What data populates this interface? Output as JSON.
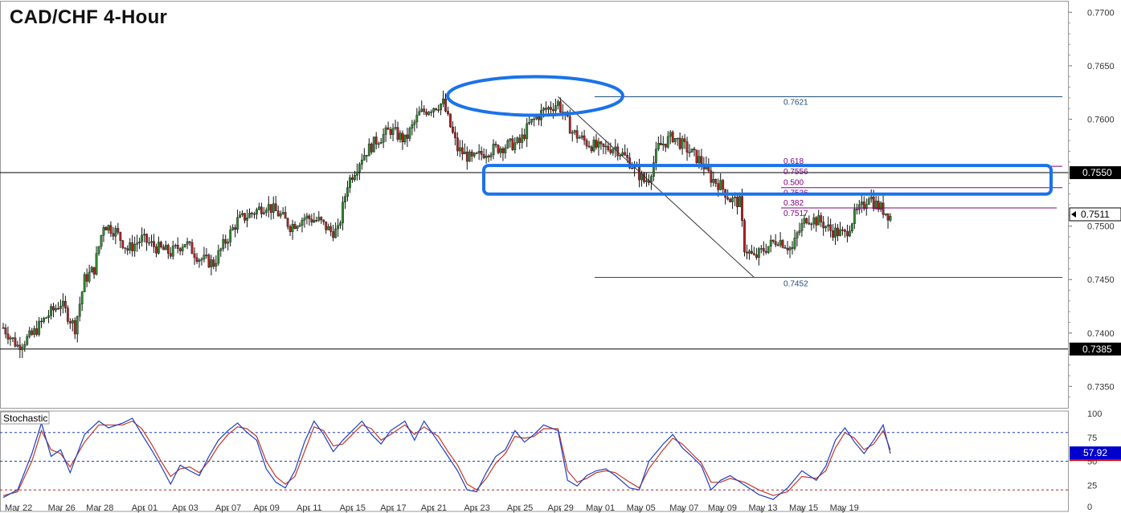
{
  "chart_data": {
    "type": "candlestick",
    "title": "CAD/CHF 4-Hour",
    "price_axis": {
      "ylim": [
        0.733,
        0.771
      ],
      "ticks": [
        "0.7350",
        "0.7400",
        "0.7450",
        "0.7500",
        "0.7550",
        "0.7600",
        "0.7650",
        "0.7700"
      ],
      "current_price_label": "0.7511",
      "current_price": 0.7511,
      "marked_levels": [
        {
          "label": "0.7550",
          "value": 0.755,
          "style": "black-horizontal"
        },
        {
          "label": "0.7385",
          "value": 0.7385,
          "style": "black-horizontal"
        }
      ]
    },
    "x_labels": [
      "Mar 22",
      "Mar 26",
      "Mar 28",
      "Apr 01",
      "Apr 03",
      "Apr 07",
      "Apr 09",
      "Apr 11",
      "Apr 15",
      "Apr 17",
      "Apr 21",
      "Apr 23",
      "Apr 25",
      "Apr 29",
      "May 01",
      "May 05",
      "May 07",
      "May 09",
      "May 13",
      "May 15",
      "May 19"
    ],
    "series": [
      {
        "name": "CAD/CHF",
        "close_path": [
          [
            0,
            0.7405
          ],
          [
            6,
            0.7388
          ],
          [
            12,
            0.7398
          ],
          [
            18,
            0.7415
          ],
          [
            24,
            0.7428
          ],
          [
            30,
            0.7405
          ],
          [
            34,
            0.745
          ],
          [
            38,
            0.746
          ],
          [
            42,
            0.7502
          ],
          [
            47,
            0.7495
          ],
          [
            52,
            0.7478
          ],
          [
            58,
            0.7488
          ],
          [
            64,
            0.748
          ],
          [
            70,
            0.7475
          ],
          [
            76,
            0.7485
          ],
          [
            82,
            0.747
          ],
          [
            88,
            0.7465
          ],
          [
            92,
            0.7482
          ],
          [
            98,
            0.7505
          ],
          [
            104,
            0.7512
          ],
          [
            110,
            0.752
          ],
          [
            116,
            0.751
          ],
          [
            120,
            0.75
          ],
          [
            126,
            0.7508
          ],
          [
            132,
            0.7505
          ],
          [
            137,
            0.7495
          ],
          [
            140,
            0.7495
          ],
          [
            144,
            0.754
          ],
          [
            150,
            0.7565
          ],
          [
            156,
            0.758
          ],
          [
            162,
            0.759
          ],
          [
            168,
            0.758
          ],
          [
            174,
            0.7605
          ],
          [
            180,
            0.7612
          ],
          [
            184,
            0.7615
          ],
          [
            186,
            0.76
          ],
          [
            190,
            0.7572
          ],
          [
            196,
            0.7562
          ],
          [
            202,
            0.757
          ],
          [
            210,
            0.7575
          ],
          [
            216,
            0.7578
          ],
          [
            220,
            0.7595
          ],
          [
            226,
            0.7608
          ],
          [
            232,
            0.7615
          ],
          [
            234,
            0.7606
          ],
          [
            238,
            0.7588
          ],
          [
            244,
            0.7578
          ],
          [
            250,
            0.7572
          ],
          [
            256,
            0.7574
          ],
          [
            262,
            0.756
          ],
          [
            266,
            0.7548
          ],
          [
            268,
            0.7542
          ],
          [
            270,
            0.7545
          ],
          [
            274,
            0.7574
          ],
          [
            280,
            0.7584
          ],
          [
            286,
            0.7572
          ],
          [
            292,
            0.756
          ],
          [
            296,
            0.7545
          ],
          [
            300,
            0.7538
          ],
          [
            304,
            0.7525
          ],
          [
            308,
            0.7522
          ],
          [
            310,
            0.748
          ],
          [
            314,
            0.747
          ],
          [
            318,
            0.7478
          ],
          [
            324,
            0.7488
          ],
          [
            330,
            0.7478
          ],
          [
            332,
            0.7492
          ],
          [
            336,
            0.7508
          ],
          [
            342,
            0.7504
          ],
          [
            346,
            0.7496
          ],
          [
            352,
            0.7492
          ],
          [
            356,
            0.751
          ],
          [
            360,
            0.752
          ],
          [
            362,
            0.753
          ],
          [
            364,
            0.7522
          ],
          [
            368,
            0.7515
          ],
          [
            371,
            0.7509
          ]
        ]
      }
    ],
    "annotations": {
      "fibonacci": [
        {
          "label": "0.7621",
          "value": 0.7621
        },
        {
          "label": "0.618",
          "value": 0.7556
        },
        {
          "label": "0.7556",
          "value": 0.7556
        },
        {
          "label": "0.500",
          "value": 0.7536
        },
        {
          "label": "0.7536",
          "value": 0.7536
        },
        {
          "label": "0.382",
          "value": 0.7517
        },
        {
          "label": "0.7517",
          "value": 0.7517
        },
        {
          "label": "0.7452",
          "value": 0.7452
        }
      ],
      "highlights": [
        "ellipse around double top near 0.7621",
        "rectangle around 0.7536–0.7556 zone"
      ]
    },
    "stochastic": {
      "label": "Stochastic",
      "ylim": [
        0,
        100
      ],
      "ticks": [
        "100",
        "75",
        "50",
        "25",
        "0"
      ],
      "levels": [
        80,
        50,
        20
      ],
      "current_label": "57.92",
      "current_value": 57.92,
      "k_path": [
        [
          0,
          12
        ],
        [
          6,
          20
        ],
        [
          12,
          58
        ],
        [
          16,
          90
        ],
        [
          20,
          55
        ],
        [
          24,
          62
        ],
        [
          28,
          38
        ],
        [
          34,
          78
        ],
        [
          40,
          92
        ],
        [
          44,
          85
        ],
        [
          50,
          90
        ],
        [
          54,
          95
        ],
        [
          58,
          78
        ],
        [
          62,
          62
        ],
        [
          66,
          45
        ],
        [
          70,
          26
        ],
        [
          74,
          46
        ],
        [
          78,
          40
        ],
        [
          82,
          35
        ],
        [
          86,
          55
        ],
        [
          90,
          72
        ],
        [
          94,
          82
        ],
        [
          98,
          90
        ],
        [
          102,
          80
        ],
        [
          106,
          72
        ],
        [
          110,
          42
        ],
        [
          114,
          28
        ],
        [
          118,
          22
        ],
        [
          122,
          40
        ],
        [
          126,
          70
        ],
        [
          130,
          92
        ],
        [
          134,
          78
        ],
        [
          138,
          60
        ],
        [
          142,
          72
        ],
        [
          146,
          82
        ],
        [
          150,
          92
        ],
        [
          154,
          78
        ],
        [
          158,
          68
        ],
        [
          162,
          82
        ],
        [
          168,
          92
        ],
        [
          172,
          72
        ],
        [
          176,
          92
        ],
        [
          182,
          70
        ],
        [
          186,
          55
        ],
        [
          190,
          40
        ],
        [
          194,
          20
        ],
        [
          198,
          18
        ],
        [
          202,
          38
        ],
        [
          206,
          55
        ],
        [
          210,
          62
        ],
        [
          214,
          82
        ],
        [
          218,
          70
        ],
        [
          222,
          78
        ],
        [
          226,
          88
        ],
        [
          232,
          82
        ],
        [
          236,
          30
        ],
        [
          240,
          24
        ],
        [
          244,
          35
        ],
        [
          248,
          40
        ],
        [
          252,
          42
        ],
        [
          256,
          35
        ],
        [
          262,
          22
        ],
        [
          266,
          20
        ],
        [
          270,
          50
        ],
        [
          276,
          68
        ],
        [
          280,
          78
        ],
        [
          284,
          64
        ],
        [
          288,
          55
        ],
        [
          292,
          45
        ],
        [
          296,
          20
        ],
        [
          300,
          30
        ],
        [
          304,
          35
        ],
        [
          310,
          25
        ],
        [
          316,
          15
        ],
        [
          322,
          10
        ],
        [
          328,
          22
        ],
        [
          334,
          40
        ],
        [
          340,
          30
        ],
        [
          344,
          45
        ],
        [
          348,
          72
        ],
        [
          352,
          85
        ],
        [
          356,
          70
        ],
        [
          360,
          58
        ],
        [
          364,
          72
        ],
        [
          368,
          88
        ],
        [
          371,
          58
        ]
      ],
      "d_path": [
        [
          0,
          14
        ],
        [
          6,
          18
        ],
        [
          12,
          50
        ],
        [
          16,
          82
        ],
        [
          20,
          62
        ],
        [
          24,
          58
        ],
        [
          28,
          44
        ],
        [
          34,
          70
        ],
        [
          40,
          88
        ],
        [
          44,
          88
        ],
        [
          50,
          88
        ],
        [
          54,
          92
        ],
        [
          58,
          84
        ],
        [
          62,
          68
        ],
        [
          66,
          50
        ],
        [
          70,
          34
        ],
        [
          74,
          42
        ],
        [
          78,
          44
        ],
        [
          82,
          38
        ],
        [
          86,
          50
        ],
        [
          90,
          66
        ],
        [
          94,
          78
        ],
        [
          98,
          86
        ],
        [
          102,
          84
        ],
        [
          106,
          76
        ],
        [
          110,
          50
        ],
        [
          114,
          34
        ],
        [
          118,
          26
        ],
        [
          122,
          34
        ],
        [
          126,
          60
        ],
        [
          130,
          86
        ],
        [
          134,
          82
        ],
        [
          138,
          66
        ],
        [
          142,
          68
        ],
        [
          146,
          78
        ],
        [
          150,
          88
        ],
        [
          154,
          84
        ],
        [
          158,
          72
        ],
        [
          162,
          78
        ],
        [
          168,
          88
        ],
        [
          172,
          78
        ],
        [
          176,
          86
        ],
        [
          182,
          76
        ],
        [
          186,
          60
        ],
        [
          190,
          46
        ],
        [
          194,
          26
        ],
        [
          198,
          20
        ],
        [
          202,
          32
        ],
        [
          206,
          48
        ],
        [
          210,
          58
        ],
        [
          214,
          76
        ],
        [
          218,
          74
        ],
        [
          222,
          76
        ],
        [
          226,
          84
        ],
        [
          232,
          84
        ],
        [
          236,
          40
        ],
        [
          240,
          28
        ],
        [
          244,
          32
        ],
        [
          248,
          38
        ],
        [
          252,
          40
        ],
        [
          256,
          38
        ],
        [
          262,
          28
        ],
        [
          266,
          22
        ],
        [
          270,
          42
        ],
        [
          276,
          62
        ],
        [
          280,
          74
        ],
        [
          284,
          68
        ],
        [
          288,
          58
        ],
        [
          292,
          48
        ],
        [
          296,
          28
        ],
        [
          300,
          28
        ],
        [
          304,
          32
        ],
        [
          310,
          28
        ],
        [
          316,
          20
        ],
        [
          322,
          14
        ],
        [
          328,
          18
        ],
        [
          334,
          34
        ],
        [
          340,
          32
        ],
        [
          344,
          40
        ],
        [
          348,
          64
        ],
        [
          352,
          80
        ],
        [
          356,
          74
        ],
        [
          360,
          62
        ],
        [
          364,
          68
        ],
        [
          368,
          82
        ],
        [
          371,
          62
        ]
      ]
    }
  }
}
